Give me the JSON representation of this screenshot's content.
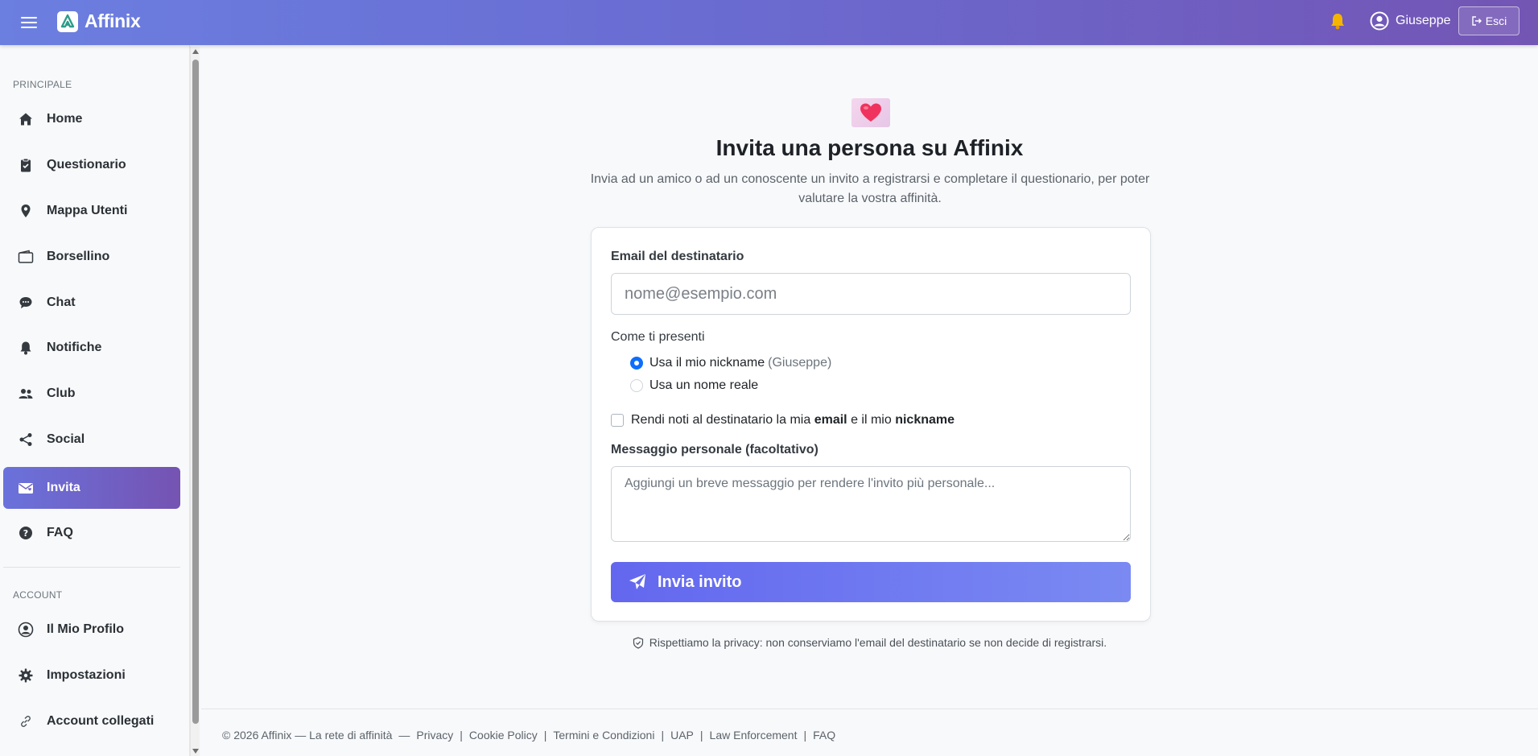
{
  "header": {
    "brand": "Affinix",
    "user_name": "Giuseppe",
    "logout_label": "Esci",
    "icons": [
      "menu-icon",
      "brand-logo-icon",
      "bell-icon",
      "user-circle-icon",
      "logout-icon"
    ],
    "gradient_colors": [
      "#6b7fe0",
      "#7355b4"
    ]
  },
  "sidebar": {
    "section_main": "PRINCIPALE",
    "section_account": "ACCOUNT",
    "items": [
      {
        "label": "Home",
        "icon": "home-icon"
      },
      {
        "label": "Questionario",
        "icon": "clipboard-icon"
      },
      {
        "label": "Mappa Utenti",
        "icon": "map-pin-icon"
      },
      {
        "label": "Borsellino",
        "icon": "wallet-icon"
      },
      {
        "label": "Chat",
        "icon": "chat-icon"
      },
      {
        "label": "Notifiche",
        "icon": "bell-icon"
      },
      {
        "label": "Club",
        "icon": "people-icon"
      },
      {
        "label": "Social",
        "icon": "share-icon"
      },
      {
        "label": "Invita",
        "icon": "envelope-heart-icon",
        "active": true
      },
      {
        "label": "FAQ",
        "icon": "question-circle-icon"
      }
    ],
    "account_items": [
      {
        "label": "Il Mio Profilo",
        "icon": "user-circle-icon"
      },
      {
        "label": "Impostazioni",
        "icon": "gear-icon"
      },
      {
        "label": "Account collegati",
        "icon": "link-icon"
      }
    ]
  },
  "main": {
    "title": "Invita una persona su Affinix",
    "subtitle": "Invia ad un amico o ad un conoscente un invito a registrarsi e completare il questionario, per poter valutare la vostra affinità.",
    "form": {
      "email_label": "Email del destinatario",
      "email_placeholder": "nome@esempio.com",
      "presentation_label": "Come ti presenti",
      "radio_nickname": "Usa il mio nickname",
      "radio_nickname_hint": "(Giuseppe)",
      "radio_realname": "Usa un nome reale",
      "checkbox_prefix": "Rendi noti al destinatario la mia",
      "checkbox_email": "email",
      "checkbox_and": "e il mio",
      "checkbox_nickname": "nickname",
      "message_label": "Messaggio personale (facoltativo)",
      "message_placeholder": "Aggiungi un breve messaggio per rendere l'invito più personale...",
      "submit_label": "Invia invito"
    },
    "privacy_note": "Rispettiamo la privacy: non conserviamo l'email del destinatario se non decide di registrarsi."
  },
  "footer": {
    "copyright": "© 2026 Affinix — La rete di affinità",
    "dash": "—",
    "links": [
      "Privacy",
      "Cookie Policy",
      "Termini e Condizioni",
      "UAP",
      "Law Enforcement",
      "FAQ"
    ]
  }
}
